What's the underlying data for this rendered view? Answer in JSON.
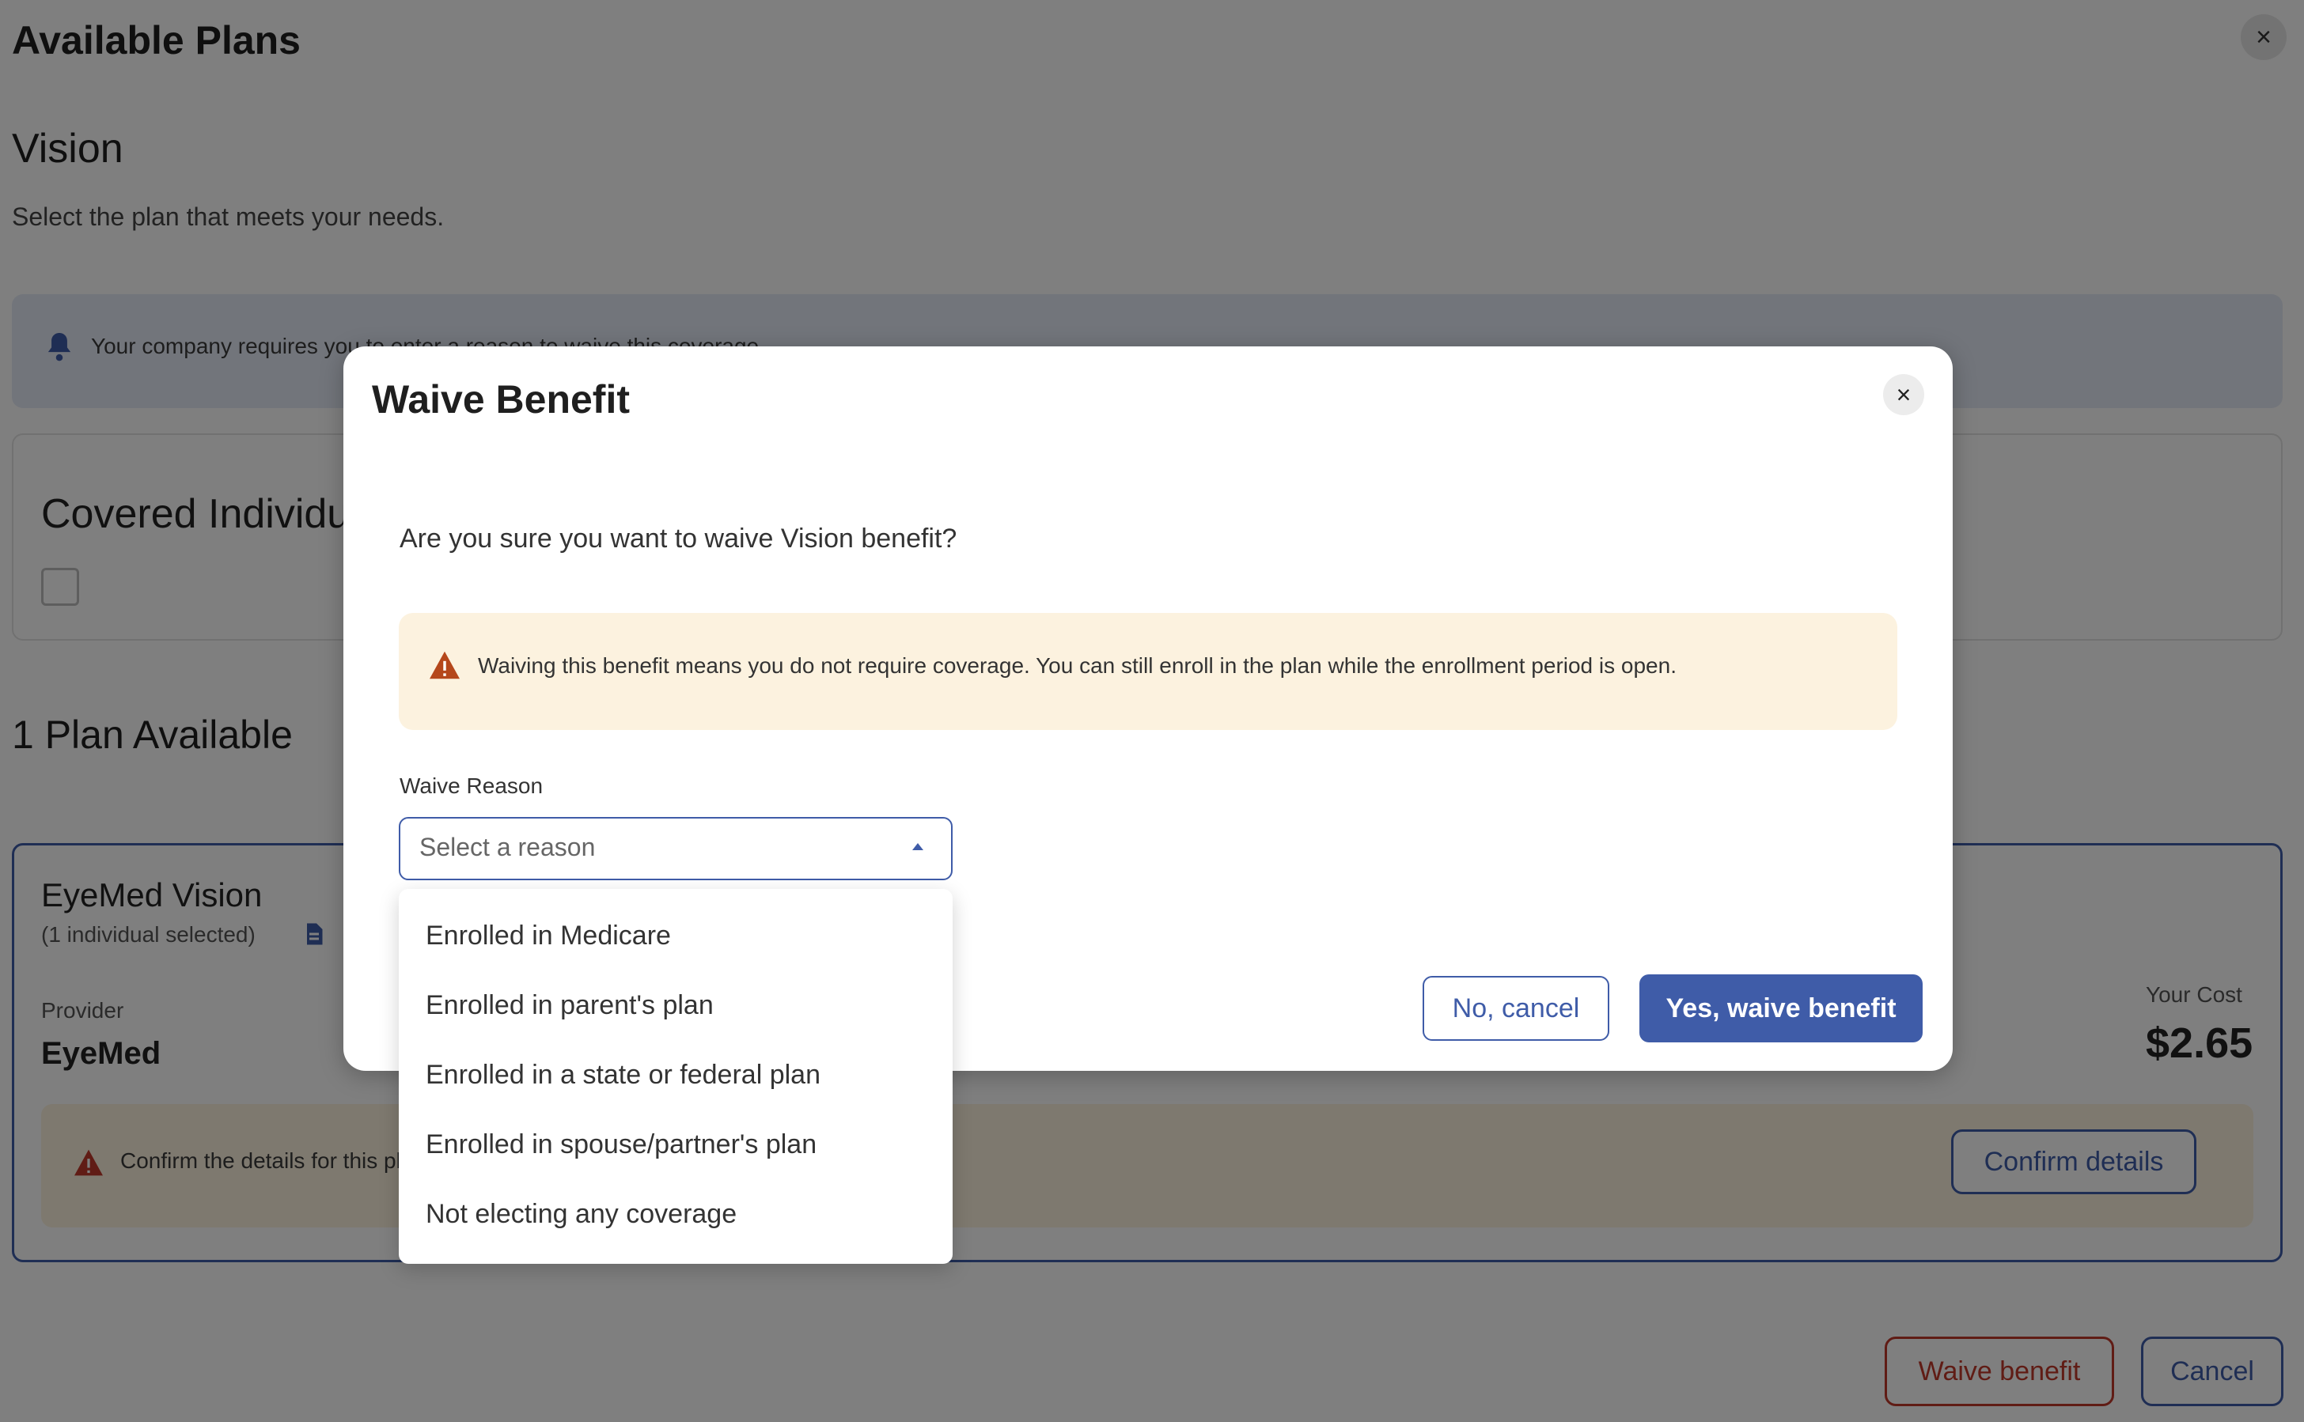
{
  "page": {
    "title": "Available Plans",
    "close_icon": "×"
  },
  "section": {
    "title": "Vision",
    "subtitle": "Select the plan that meets your needs."
  },
  "notice": {
    "icon": "bell-icon",
    "text": "Your company requires you to enter a reason to waive this coverage."
  },
  "covered": {
    "title": "Covered Individuals"
  },
  "plans": {
    "heading": "1 Plan Available",
    "card": {
      "name": "EyeMed Vision",
      "selected": "(1 individual selected)",
      "provider_label": "Provider",
      "provider": "EyeMed",
      "cost_label": "Your Cost",
      "cost": "$2.65",
      "confirm_text": "Confirm the details for this plan",
      "confirm_button": "Confirm details"
    }
  },
  "footer": {
    "waive_button": "Waive benefit",
    "cancel_button": "Cancel"
  },
  "modal": {
    "title": "Waive Benefit",
    "close_icon": "×",
    "question": "Are you sure you want to waive Vision benefit?",
    "warning": "Waiving this benefit means you do not require coverage. You can still enroll in the plan while the enrollment period is open.",
    "reason_label": "Waive Reason",
    "reason_placeholder": "Select a reason",
    "reasons": [
      "Enrolled in Medicare",
      "Enrolled in parent's plan",
      "Enrolled in a state or federal plan",
      "Enrolled in spouse/partner's plan",
      "Not electing any coverage"
    ],
    "cancel_button": "No, cancel",
    "confirm_button": "Yes, waive benefit"
  },
  "colors": {
    "primary": "#3f5ca8",
    "danger": "#c0392b",
    "warning_bg": "#fcf2df",
    "warning_icon": "#c0392b",
    "info_bg": "#e4eaf7"
  }
}
